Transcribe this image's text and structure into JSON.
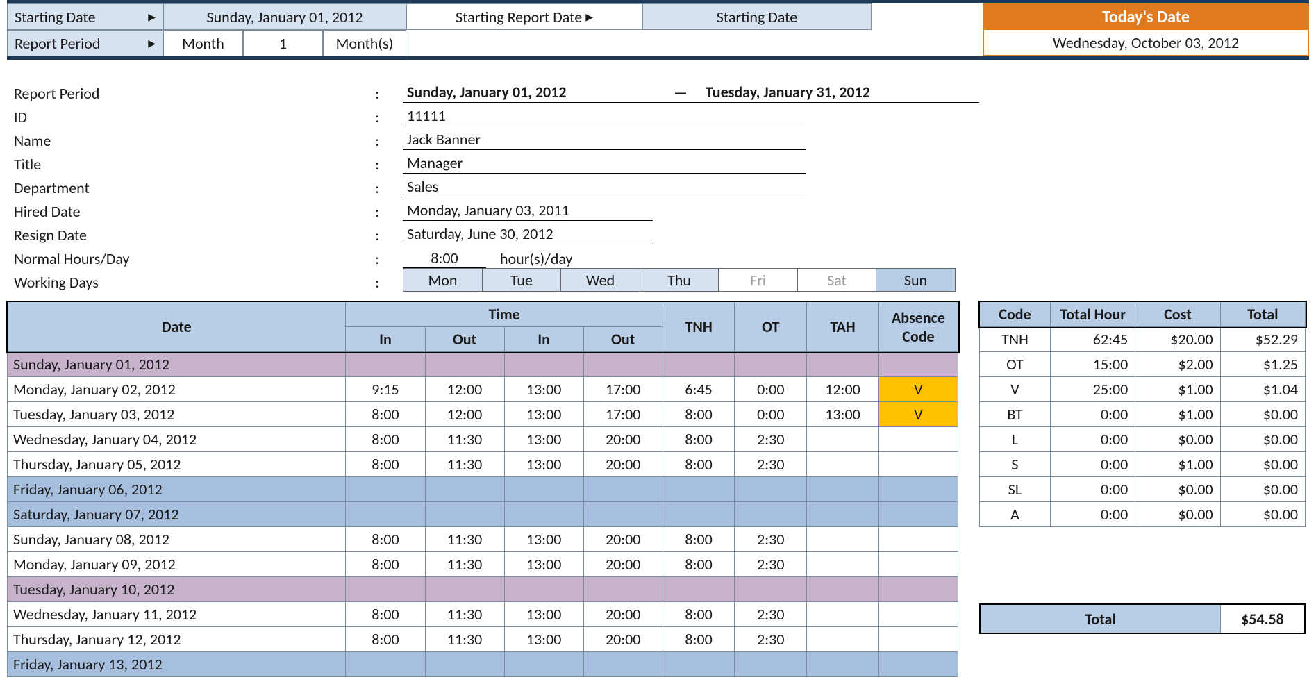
{
  "topbar": {
    "starting_date_lbl": "Starting Date",
    "starting_date_val": "Sunday, January 01, 2012",
    "report_period_lbl": "Report Period",
    "report_period_unit": "Month",
    "report_period_num": "1",
    "report_period_suffix": "Month(s)",
    "starting_report_date_lbl": "Starting Report Date",
    "starting_report_date_val": "Starting Date",
    "todays_date_lbl": "Today's Date",
    "todays_date_val": "Wednesday, October 03, 2012"
  },
  "info": {
    "report_period_lbl": "Report Period",
    "report_period_from": "Sunday, January 01, 2012",
    "report_period_to": "Tuesday, January 31, 2012",
    "dash": "—",
    "id_lbl": "ID",
    "id": "11111",
    "name_lbl": "Name",
    "name": "Jack Banner",
    "title_lbl": "Title",
    "title": "Manager",
    "dept_lbl": "Department",
    "dept": "Sales",
    "hired_lbl": "Hired Date",
    "hired": "Monday, January 03, 2011",
    "resign_lbl": "Resign Date",
    "resign": "Saturday, June 30, 2012",
    "hours_lbl": "Normal Hours/Day",
    "hours_val": "8:00",
    "hours_unit": "hour(s)/day",
    "workdays_lbl": "Working Days",
    "days": [
      "Mon",
      "Tue",
      "Wed",
      "Thu",
      "Fri",
      "Sat",
      "Sun"
    ],
    "day_state": [
      "on",
      "on",
      "on",
      "on",
      "off",
      "off",
      "sun"
    ]
  },
  "main_headers": {
    "date": "Date",
    "time": "Time",
    "in": "In",
    "out": "Out",
    "tnh": "TNH",
    "ot": "OT",
    "tah": "TAH",
    "abs": "Absence Code"
  },
  "rows": [
    {
      "date": "Sunday, January 01, 2012",
      "cls": "row-purple"
    },
    {
      "date": "Monday, January 02, 2012",
      "in1": "9:15",
      "out1": "12:00",
      "in2": "13:00",
      "out2": "17:00",
      "tnh": "6:45",
      "ot": "0:00",
      "tah": "12:00",
      "abs": "V"
    },
    {
      "date": "Tuesday, January 03, 2012",
      "in1": "8:00",
      "out1": "12:00",
      "in2": "13:00",
      "out2": "17:00",
      "tnh": "8:00",
      "ot": "0:00",
      "tah": "13:00",
      "abs": "V"
    },
    {
      "date": "Wednesday, January 04, 2012",
      "in1": "8:00",
      "out1": "11:30",
      "in2": "13:00",
      "out2": "20:00",
      "tnh": "8:00",
      "ot": "2:30"
    },
    {
      "date": "Thursday, January 05, 2012",
      "in1": "8:00",
      "out1": "11:30",
      "in2": "13:00",
      "out2": "20:00",
      "tnh": "8:00",
      "ot": "2:30"
    },
    {
      "date": "Friday, January 06, 2012",
      "cls": "row-blue"
    },
    {
      "date": "Saturday, January 07, 2012",
      "cls": "row-blue"
    },
    {
      "date": "Sunday, January 08, 2012",
      "in1": "8:00",
      "out1": "11:30",
      "in2": "13:00",
      "out2": "20:00",
      "tnh": "8:00",
      "ot": "2:30"
    },
    {
      "date": "Monday, January 09, 2012",
      "in1": "8:00",
      "out1": "11:30",
      "in2": "13:00",
      "out2": "20:00",
      "tnh": "8:00",
      "ot": "2:30"
    },
    {
      "date": "Tuesday, January 10, 2012",
      "cls": "row-purple"
    },
    {
      "date": "Wednesday, January 11, 2012",
      "in1": "8:00",
      "out1": "11:30",
      "in2": "13:00",
      "out2": "20:00",
      "tnh": "8:00",
      "ot": "2:30"
    },
    {
      "date": "Thursday, January 12, 2012",
      "in1": "8:00",
      "out1": "11:30",
      "in2": "13:00",
      "out2": "20:00",
      "tnh": "8:00",
      "ot": "2:30"
    },
    {
      "date": "Friday, January 13, 2012",
      "cls": "row-blue"
    }
  ],
  "side_headers": {
    "code": "Code",
    "total_hour": "Total Hour",
    "cost": "Cost",
    "total": "Total"
  },
  "side_rows": [
    {
      "code": "TNH",
      "hour": "62:45",
      "cost": "$20.00",
      "total": "$52.29"
    },
    {
      "code": "OT",
      "hour": "15:00",
      "cost": "$2.00",
      "total": "$1.25"
    },
    {
      "code": "V",
      "hour": "25:00",
      "cost": "$1.00",
      "total": "$1.04"
    },
    {
      "code": "BT",
      "hour": "0:00",
      "cost": "$1.00",
      "total": "$0.00"
    },
    {
      "code": "L",
      "hour": "0:00",
      "cost": "$0.00",
      "total": "$0.00"
    },
    {
      "code": "S",
      "hour": "0:00",
      "cost": "$1.00",
      "total": "$0.00"
    },
    {
      "code": "SL",
      "hour": "0:00",
      "cost": "$0.00",
      "total": "$0.00"
    },
    {
      "code": "A",
      "hour": "0:00",
      "cost": "$0.00",
      "total": "$0.00"
    }
  ],
  "grand_total": {
    "lbl": "Total",
    "val": "$54.58"
  }
}
